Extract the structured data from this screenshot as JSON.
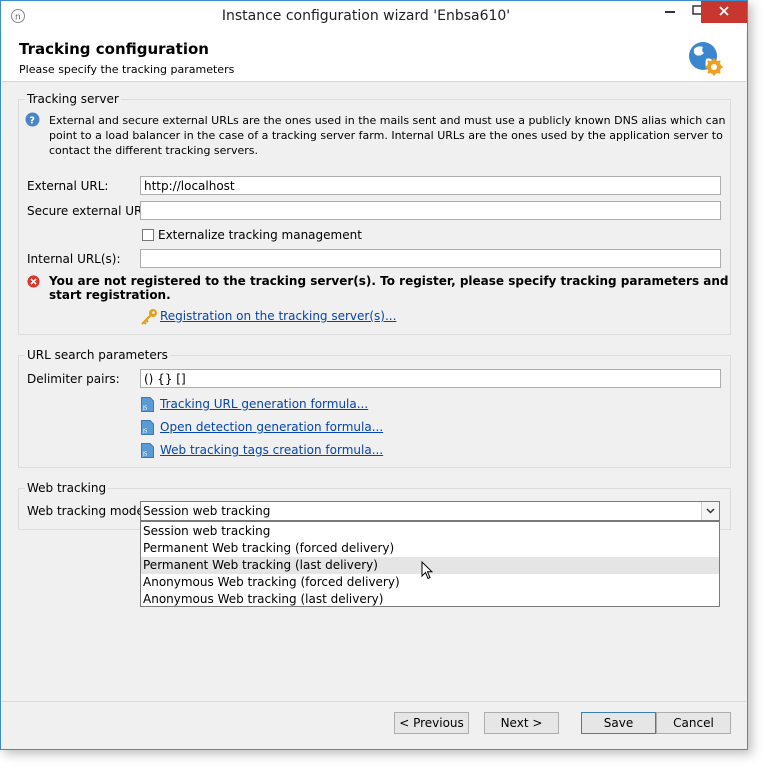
{
  "window": {
    "title": "Instance configuration wizard 'Enbsa610'"
  },
  "header": {
    "title": "Tracking configuration",
    "subtitle": "Please specify the tracking parameters"
  },
  "tracking_server": {
    "legend": "Tracking server",
    "info_line1": "External and secure external URLs are the ones used in the mails sent and must use a publicly known DNS alias which can",
    "info_line2": "point to a load balancer in the case of a tracking server farm. Internal URLs are the ones used by the application server to",
    "info_line3": "contact the different tracking servers.",
    "external_url_label": "External URL:",
    "external_url_value": "http://localhost",
    "secure_url_label": "Secure external URL:",
    "secure_url_value": "",
    "externalize_label": "Externalize tracking management",
    "externalize_checked": false,
    "internal_urls_label": "Internal URL(s):",
    "internal_urls_value": "",
    "error_message": "You are not registered to the tracking server(s). To register, please specify tracking parameters and start registration.",
    "registration_link": "Registration on the tracking server(s)..."
  },
  "url_search": {
    "legend": "URL search parameters",
    "delimiter_label": "Delimiter pairs:",
    "delimiter_value": "() {} []",
    "link_tracking_formula": "Tracking URL generation formula...",
    "link_open_detection": "Open detection generation formula...",
    "link_web_tags": "Web tracking tags creation formula..."
  },
  "web_tracking": {
    "legend": "Web tracking",
    "mode_label": "Web tracking mode:",
    "selected": "Session web tracking",
    "options": [
      "Session web tracking",
      "Permanent Web tracking (forced delivery)",
      "Permanent Web tracking (last delivery)",
      "Anonymous Web tracking (forced delivery)",
      "Anonymous Web tracking (last delivery)"
    ],
    "hovered_option": "Permanent Web tracking (last delivery)"
  },
  "footer": {
    "previous": "< Previous",
    "next": "Next >",
    "save": "Save",
    "cancel": "Cancel"
  },
  "colors": {
    "window_border": "#3c8dd0",
    "close_button": "#c7372f",
    "link": "#0645ad",
    "info_icon": "#4a86c5",
    "error_icon": "#d9362e",
    "key_icon": "#e0a020"
  }
}
